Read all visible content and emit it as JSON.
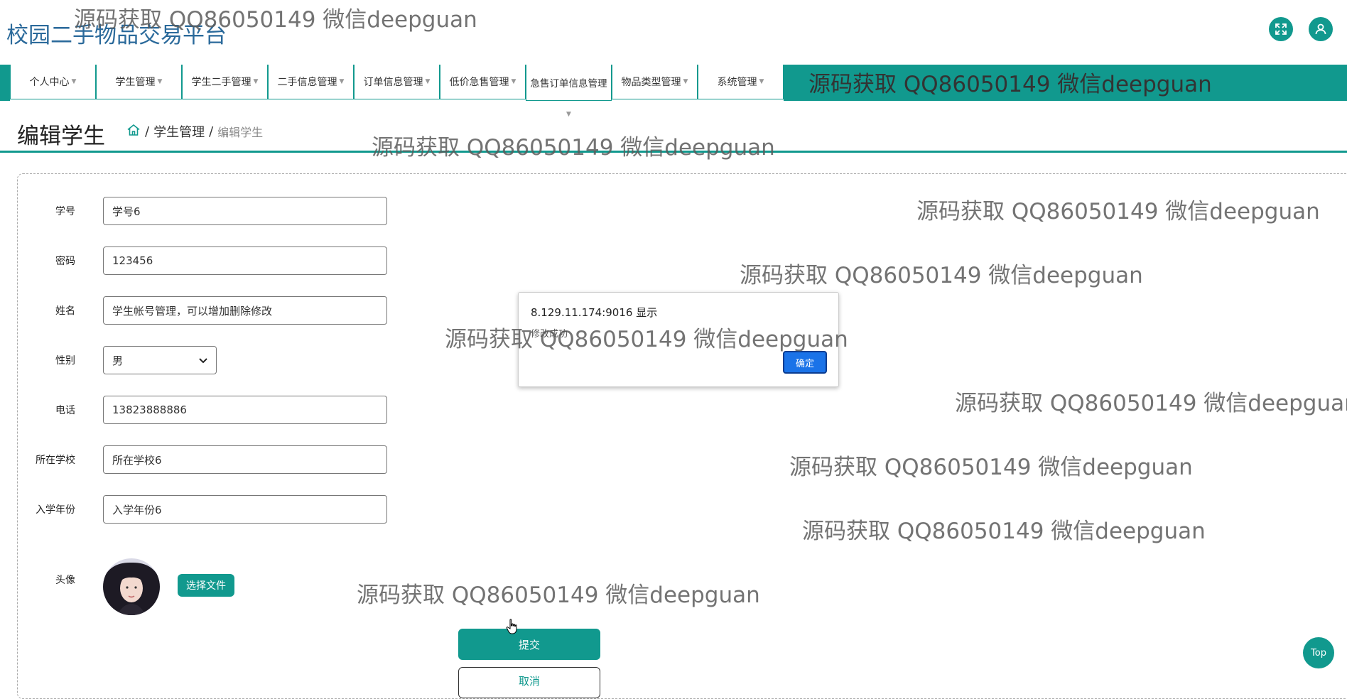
{
  "app": {
    "title": "校园二手物品交易平台"
  },
  "nav": {
    "items": [
      {
        "label": "个人中心"
      },
      {
        "label": "学生管理"
      },
      {
        "label": "学生二手管理"
      },
      {
        "label": "二手信息管理"
      },
      {
        "label": "订单信息管理"
      },
      {
        "label": "低价急售管理"
      },
      {
        "label": "急售订单信息管理"
      },
      {
        "label": "物品类型管理"
      },
      {
        "label": "系统管理"
      }
    ]
  },
  "page": {
    "title": "编辑学生",
    "breadcrumb": {
      "separator": "/",
      "section": "学生管理",
      "current": "编辑学生"
    }
  },
  "form": {
    "fields": {
      "student_id": {
        "label": "学号",
        "value": "学号6"
      },
      "password": {
        "label": "密码",
        "value": "123456"
      },
      "name": {
        "label": "姓名",
        "value": "学生帐号管理，可以增加删除修改"
      },
      "gender": {
        "label": "性别",
        "value": "男"
      },
      "phone": {
        "label": "电话",
        "value": "13823888886"
      },
      "school": {
        "label": "所在学校",
        "value": "所在学校6"
      },
      "enroll_year": {
        "label": "入学年份",
        "value": "入学年份6"
      },
      "avatar": {
        "label": "头像"
      }
    },
    "choose_file_label": "选择文件",
    "submit_label": "提交",
    "cancel_label": "取消"
  },
  "dialog": {
    "title": "8.129.11.174:9016 显示",
    "message": "修改成功",
    "ok_label": "确定"
  },
  "back_to_top_label": "Top",
  "watermark_text": "源码获取 QQ86050149 微信deepguan",
  "colors": {
    "accent": "#11998e",
    "title_blue": "#2b6a9b",
    "dialog_button": "#1a73e8"
  },
  "icons": [
    "fullscreen-icon",
    "user-icon",
    "home-icon",
    "caret-down-icon",
    "hand-cursor-icon"
  ]
}
